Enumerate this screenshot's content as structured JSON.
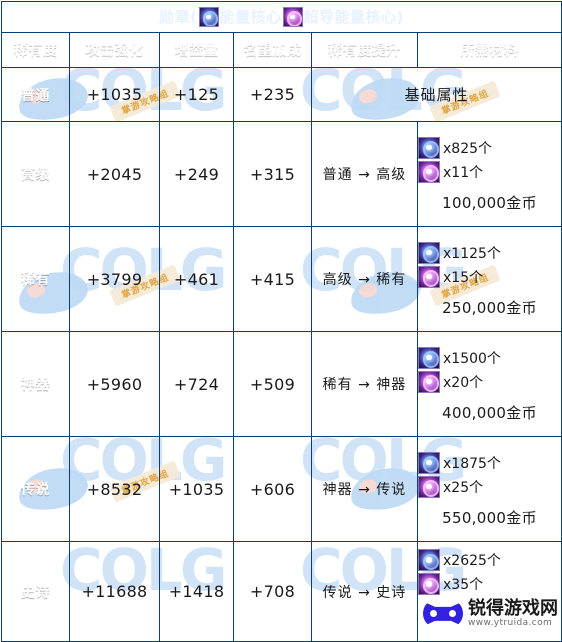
{
  "title": {
    "prefix": "勋章(",
    "item1_label": "能量核心",
    "item2_label": "超导能量核心",
    "suffix": ")",
    "item1_icon": "energy-core-icon",
    "item2_icon": "superconductive-energy-core-icon"
  },
  "columns": [
    "稀有度",
    "攻击强化",
    "增益量",
    "名望加成",
    "稀有度提升",
    "所需材料"
  ],
  "basic_attr_label": "基础属性",
  "rows": [
    {
      "rarity": "普通",
      "attack": "+1035",
      "buff": "+125",
      "fame": "+235",
      "upgrade": "",
      "materials": [],
      "gold": "",
      "basic": "基础属性"
    },
    {
      "rarity": "高级",
      "attack": "+2045",
      "buff": "+249",
      "fame": "+315",
      "upgrade": "普通 → 高级",
      "materials": [
        {
          "icon": "energy-core-icon",
          "count": "x825个"
        },
        {
          "icon": "superconductive-energy-core-icon",
          "count": "x11个"
        }
      ],
      "gold": "100,000金币",
      "basic": ""
    },
    {
      "rarity": "稀有",
      "attack": "+3799",
      "buff": "+461",
      "fame": "+415",
      "upgrade": "高级 → 稀有",
      "materials": [
        {
          "icon": "energy-core-icon",
          "count": "x1125个"
        },
        {
          "icon": "superconductive-energy-core-icon",
          "count": "x15个"
        }
      ],
      "gold": "250,000金币",
      "basic": ""
    },
    {
      "rarity": "神器",
      "attack": "+5960",
      "buff": "+724",
      "fame": "+509",
      "upgrade": "稀有 → 神器",
      "materials": [
        {
          "icon": "energy-core-icon",
          "count": "x1500个"
        },
        {
          "icon": "superconductive-energy-core-icon",
          "count": "x20个"
        }
      ],
      "gold": "400,000金币",
      "basic": ""
    },
    {
      "rarity": "传说",
      "attack": "+8532",
      "buff": "+1035",
      "fame": "+606",
      "upgrade": "神器 → 传说",
      "materials": [
        {
          "icon": "energy-core-icon",
          "count": "x1875个"
        },
        {
          "icon": "superconductive-energy-core-icon",
          "count": "x25个"
        }
      ],
      "gold": "550,000金币",
      "basic": ""
    },
    {
      "rarity": "史诗",
      "attack": "+11688",
      "buff": "+1418",
      "fame": "+708",
      "upgrade": "传说 → 史诗",
      "materials": [
        {
          "icon": "energy-core-icon",
          "count": "x2625个"
        },
        {
          "icon": "superconductive-energy-core-icon",
          "count": "x35个"
        }
      ],
      "gold": "",
      "basic": ""
    }
  ],
  "watermarks": {
    "colg_text": "COLG",
    "ribbon_text": "掌游攻略组",
    "site_name": "锐得游戏网",
    "site_url": "www.ytruida.com"
  },
  "colors": {
    "header_blue": "#1769c4",
    "title_blue": "#1565c0",
    "border": "#0b3f73",
    "watermark_blue": "#cfe3f7",
    "logo_purple": "#3322dd"
  }
}
